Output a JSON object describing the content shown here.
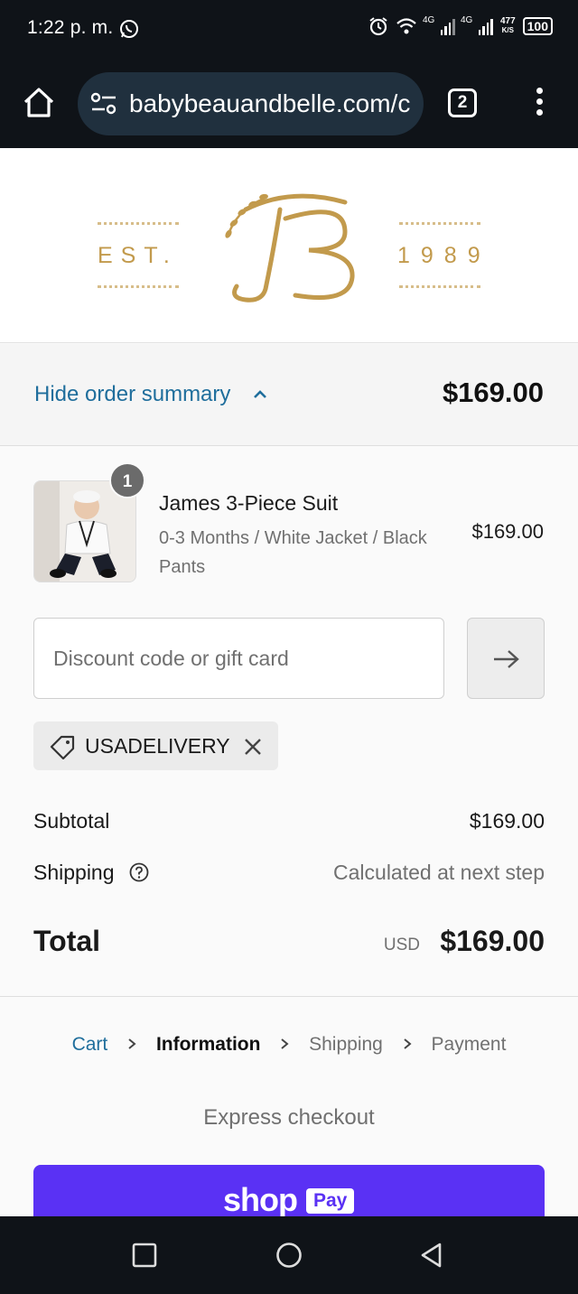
{
  "status_bar": {
    "time": "1:22 p. m.",
    "net1": "4G",
    "net2": "4G",
    "speed_value": "477",
    "speed_unit": "K/S",
    "battery": "100"
  },
  "browser": {
    "url": "babybeauandbelle.com/c",
    "tab_count": "2"
  },
  "brand": {
    "est_label": "EST.",
    "year": "1989",
    "monogram": "B",
    "brand_color": "#c29a4c"
  },
  "summary_toggle": {
    "label": "Hide order summary",
    "total": "$169.00"
  },
  "product": {
    "quantity": "1",
    "name": "James 3-Piece Suit",
    "variant": "0-3 Months / White Jacket / Black Pants",
    "price": "$169.00"
  },
  "discount": {
    "placeholder": "Discount code or gift card",
    "value": "",
    "applied_code": "USADELIVERY"
  },
  "totals": {
    "subtotal_label": "Subtotal",
    "subtotal_value": "$169.00",
    "shipping_label": "Shipping",
    "shipping_value": "Calculated at next step",
    "total_label": "Total",
    "currency": "USD",
    "total_value": "$169.00"
  },
  "breadcrumb": {
    "cart": "Cart",
    "information": "Information",
    "shipping": "Shipping",
    "payment": "Payment"
  },
  "express": {
    "label": "Express checkout",
    "shop_label": "shop",
    "pay_label": "Pay"
  },
  "colors": {
    "link": "#1f6e9c",
    "shop_pay": "#5a31f4",
    "system_bar": "#0f1318"
  }
}
